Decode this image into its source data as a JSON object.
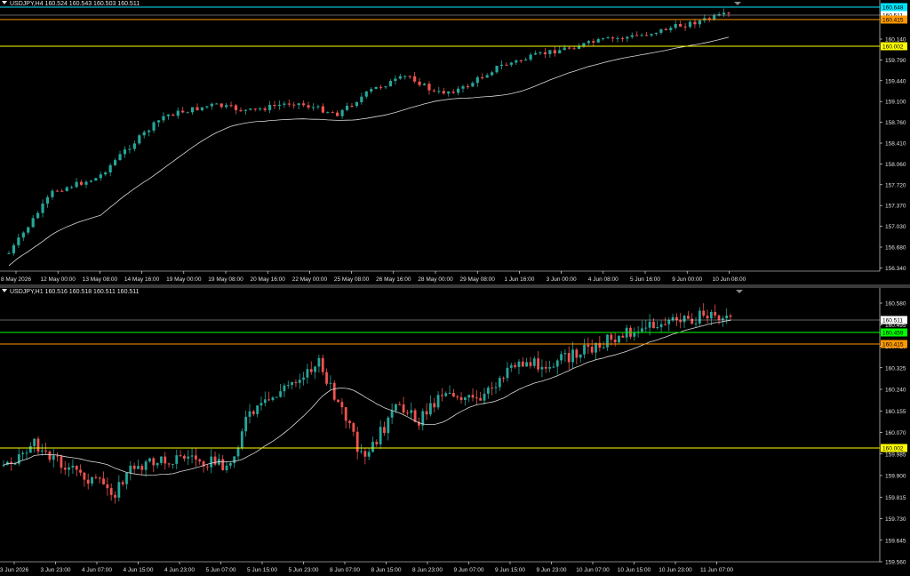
{
  "pane_h4": {
    "info": "USDJPY,H4  160.524 160.543 160.503 160.511",
    "y_ticks": [
      "160.140",
      "159.790",
      "159.440",
      "159.100",
      "158.760",
      "158.410",
      "158.060",
      "157.720",
      "157.370",
      "157.030",
      "156.680",
      "156.340"
    ],
    "x_ticks": [
      "8 May 2026",
      "12 May 00:00",
      "13 May 08:00",
      "14 May 16:00",
      "19 May 00:00",
      "19 May 08:00",
      "20 May 16:00",
      "22 May 00:00",
      "25 May 08:00",
      "26 May 16:00",
      "28 May 00:00",
      "29 May 08:00",
      "1 Jun 16:00",
      "3 Jun 00:00",
      "4 Jun 08:00",
      "5 Jun 16:00",
      "9 Jun 00:00",
      "10 Jun 08:00"
    ],
    "levels": [
      {
        "value": "160.648",
        "color": "#00e5ff",
        "text_color": "#000000"
      },
      {
        "value": "160.511",
        "color": "#ffffff",
        "text_color": "#000000"
      },
      {
        "value": "160.415",
        "color": "#ff9900",
        "text_color": "#000000"
      },
      {
        "value": "160.002",
        "color": "#ffff00",
        "text_color": "#000000"
      }
    ]
  },
  "pane_h1": {
    "info": "USDJPY,H1  160.516 160.518 160.511 160.511",
    "y_ticks": [
      "160.580",
      "160.495",
      "160.410",
      "160.325",
      "160.240",
      "160.155",
      "160.070",
      "159.985",
      "159.900",
      "159.815",
      "159.730",
      "159.645",
      "159.560"
    ],
    "x_ticks": [
      "3 Jun 2026",
      "3 Jun 23:00",
      "4 Jun 07:00",
      "4 Jun 15:00",
      "4 Jun 23:00",
      "5 Jun 07:00",
      "5 Jun 15:00",
      "5 Jun 23:00",
      "8 Jun 07:00",
      "8 Jun 15:00",
      "8 Jun 23:00",
      "9 Jun 07:00",
      "9 Jun 15:00",
      "9 Jun 23:00",
      "10 Jun 07:00",
      "10 Jun 15:00",
      "10 Jun 23:00",
      "11 Jun 07:00"
    ],
    "levels": [
      {
        "value": "160.511",
        "color": "#ffffff",
        "text_color": "#000000"
      },
      {
        "value": "160.459",
        "color": "#00ff00",
        "text_color": "#000000"
      },
      {
        "value": "160.415",
        "color": "#ff9900",
        "text_color": "#000000"
      },
      {
        "value": "160.002",
        "color": "#ffff00",
        "text_color": "#000000"
      }
    ]
  },
  "colors": {
    "bull": "#26a69a",
    "bear": "#ef5350",
    "ma": "#d8d8d8",
    "grid_text": "#e0e0e0"
  }
}
